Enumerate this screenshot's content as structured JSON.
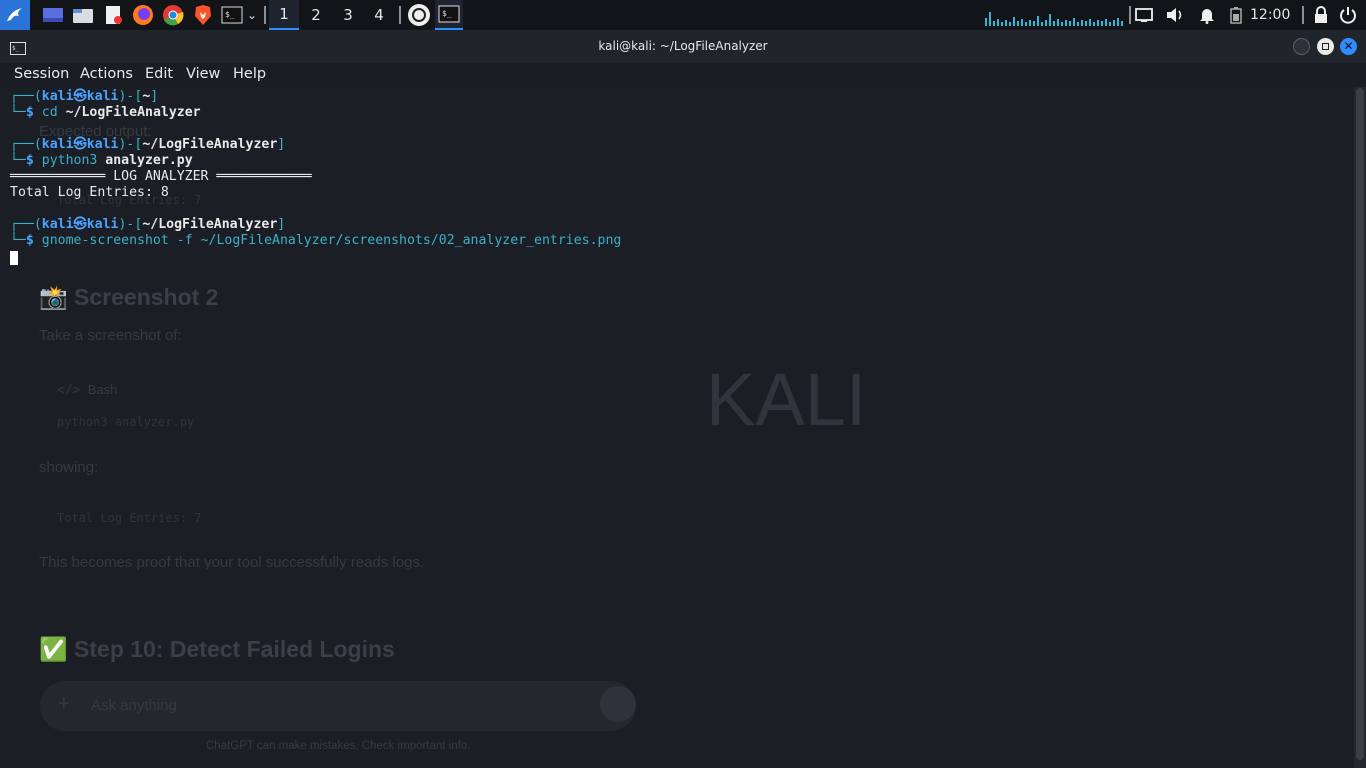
{
  "panel": {
    "workspaces": [
      "1",
      "2",
      "3",
      "4"
    ],
    "active_workspace": "1",
    "clock": "12:00",
    "icons": [
      "kali-menu-icon",
      "show-desktop-icon",
      "file-manager-icon",
      "text-editor-icon",
      "firefox-icon",
      "chrome-icon",
      "brave-icon",
      "terminal-icon",
      "chevron-down-icon",
      "chatgpt-icon",
      "terminal-window-icon",
      "cpu-graph-icon",
      "display-icon",
      "volume-icon",
      "bell-icon",
      "battery-icon",
      "lock-icon",
      "power-icon"
    ]
  },
  "window": {
    "title": "kali@kali: ~/LogFileAnalyzer",
    "menu": [
      "Session",
      "Actions",
      "Edit",
      "View",
      "Help"
    ]
  },
  "terminal": {
    "p1_open": "┌──(",
    "user": "kali",
    "at": "㉿",
    "host": "kali",
    "p1_mid": ")-[",
    "dir_home": "~",
    "dir_proj": "~/LogFileAnalyzer",
    "p1_close": "]",
    "p2": "└─",
    "dollar": "$ ",
    "cmd1": "cd",
    "cmd1_arg": " ~/LogFileAnalyzer",
    "cmd2": "python3",
    "cmd2_arg": " analyzer.py",
    "banner": "════════════ LOG ANALYZER ════════════",
    "output1": "Total Log Entries: 8",
    "cmd3": "gnome-screenshot -f ~/LogFileAnalyzer/screenshots/02_analyzer_entries.png"
  },
  "background": {
    "expected_output": "Expected output:",
    "ghost_entries": "Total Log Entries: 7",
    "screenshot_heading": "📸 Screenshot 2",
    "take_screenshot": "Take a screenshot of:",
    "bash_label": "Bash",
    "ghost_cmd": "python3 analyzer.py",
    "showing": "showing:",
    "ghost_entries2": "Total Log Entries: 7",
    "proof": "This becomes proof that your tool successfully reads logs.",
    "step10": "✅ Step 10: Detect Failed Logins",
    "ask": "Ask anything",
    "disclaimer": "ChatGPT can make mistakes. Check important info.",
    "kali_watermark": "KALI"
  }
}
